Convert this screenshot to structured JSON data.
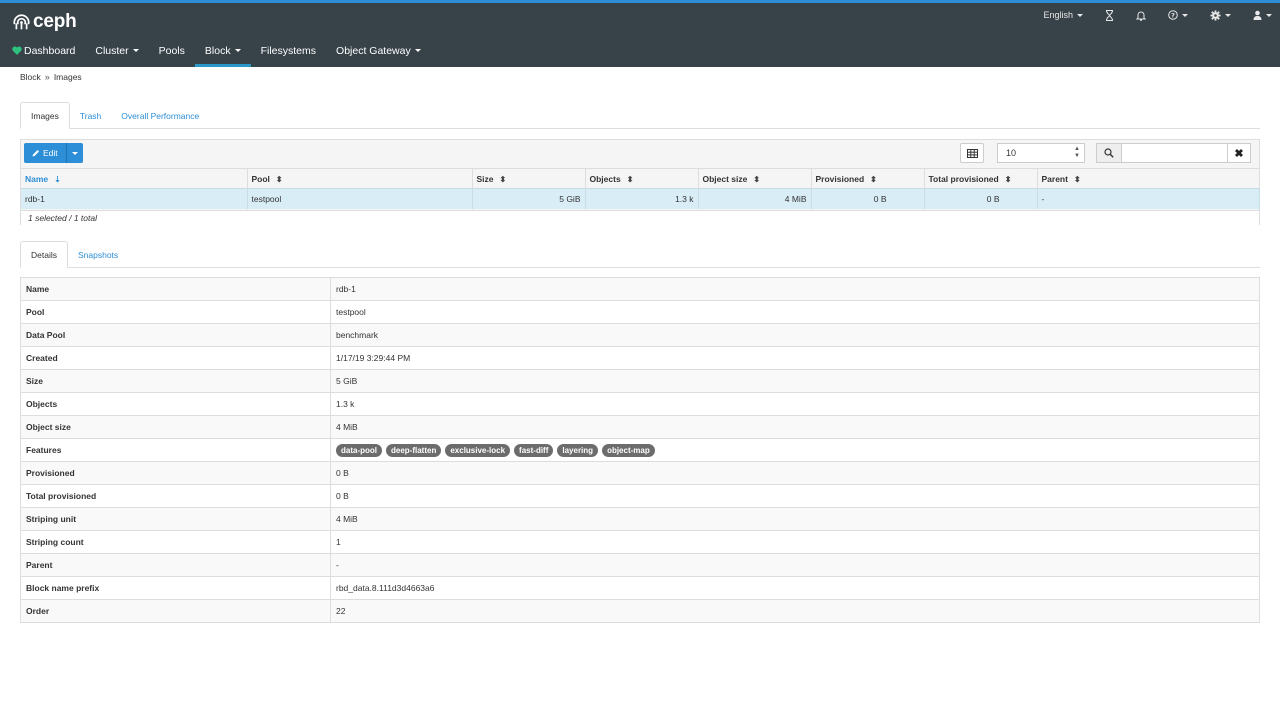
{
  "brand": "ceph",
  "language": "English",
  "nav": [
    "Dashboard",
    "Cluster",
    "Pools",
    "Block",
    "Filesystems",
    "Object Gateway"
  ],
  "nav_active": "Block",
  "breadcrumb": [
    "Block",
    "Images"
  ],
  "image_tabs": [
    "Images",
    "Trash",
    "Overall Performance"
  ],
  "toolbar": {
    "edit_label": "Edit",
    "limit_value": "10"
  },
  "table": {
    "columns": [
      "Name",
      "Pool",
      "Size",
      "Objects",
      "Object size",
      "Provisioned",
      "Total provisioned",
      "Parent"
    ],
    "rows": [
      [
        "rdb-1",
        "testpool",
        "5 GiB",
        "1.3 k",
        "4 MiB",
        "0 B",
        "0 B",
        "-"
      ]
    ],
    "footer": "1 selected / 1 total"
  },
  "detail_tabs": [
    "Details",
    "Snapshots"
  ],
  "details": [
    {
      "key": "Name",
      "value": "rdb-1"
    },
    {
      "key": "Pool",
      "value": "testpool"
    },
    {
      "key": "Data Pool",
      "value": "benchmark"
    },
    {
      "key": "Created",
      "value": "1/17/19 3:29:44 PM"
    },
    {
      "key": "Size",
      "value": "5 GiB"
    },
    {
      "key": "Objects",
      "value": "1.3 k"
    },
    {
      "key": "Object size",
      "value": "4 MiB"
    },
    {
      "key": "Features",
      "badges": [
        "data-pool",
        "deep-flatten",
        "exclusive-lock",
        "fast-diff",
        "layering",
        "object-map"
      ]
    },
    {
      "key": "Provisioned",
      "value": "0 B"
    },
    {
      "key": "Total provisioned",
      "value": "0 B"
    },
    {
      "key": "Striping unit",
      "value": "4 MiB"
    },
    {
      "key": "Striping count",
      "value": "1"
    },
    {
      "key": "Parent",
      "value": "-"
    },
    {
      "key": "Block name prefix",
      "value": "rbd_data.8.111d3d4663a6"
    },
    {
      "key": "Order",
      "value": "22"
    }
  ],
  "colors": {
    "accent": "#2b8ed6",
    "navbar": "#374249",
    "selected_row": "#d9edf7",
    "health_ok": "#2ec27e"
  }
}
